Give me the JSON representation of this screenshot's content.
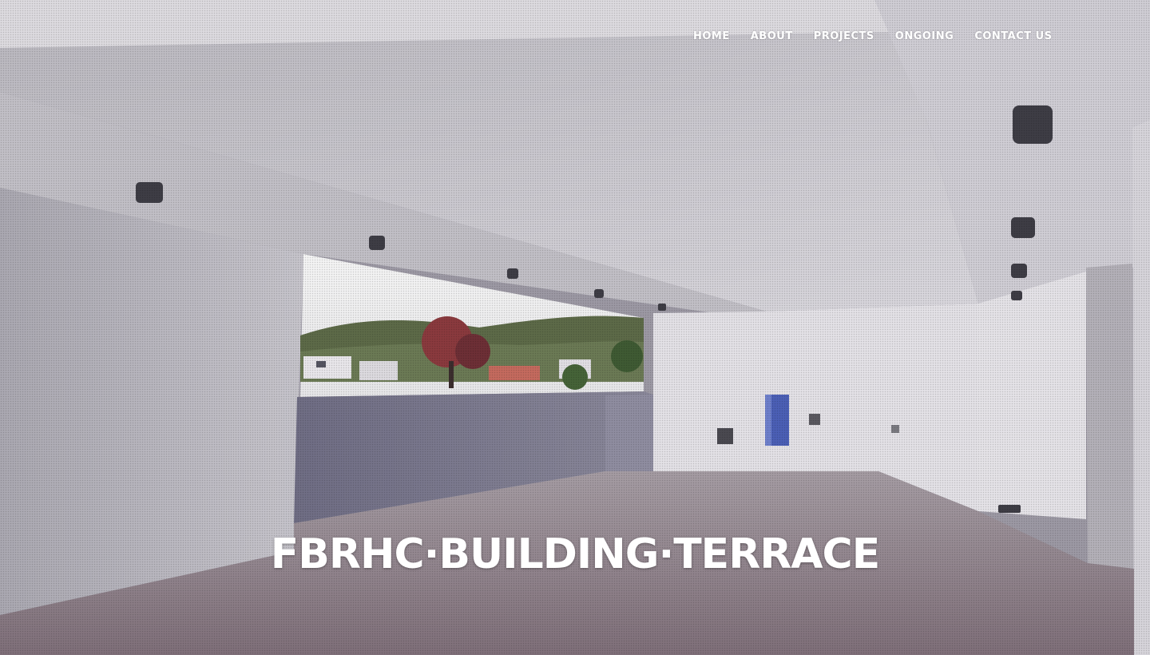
{
  "nav": {
    "items": [
      {
        "label": "HOME"
      },
      {
        "label": "ABOUT"
      },
      {
        "label": "PROJECTS"
      },
      {
        "label": "ONGOING"
      },
      {
        "label": "CONTACT US"
      }
    ]
  },
  "hero": {
    "title": "FBRHC·BUILDING·TERRACE",
    "image_icon": "building-terrace-photo"
  },
  "colors": {
    "nav_text": "#ffffff",
    "title_text": "#ffffff",
    "wall": "#d8d6dc",
    "floor": "#8a7f86",
    "parapet": "#7b7a8f"
  }
}
